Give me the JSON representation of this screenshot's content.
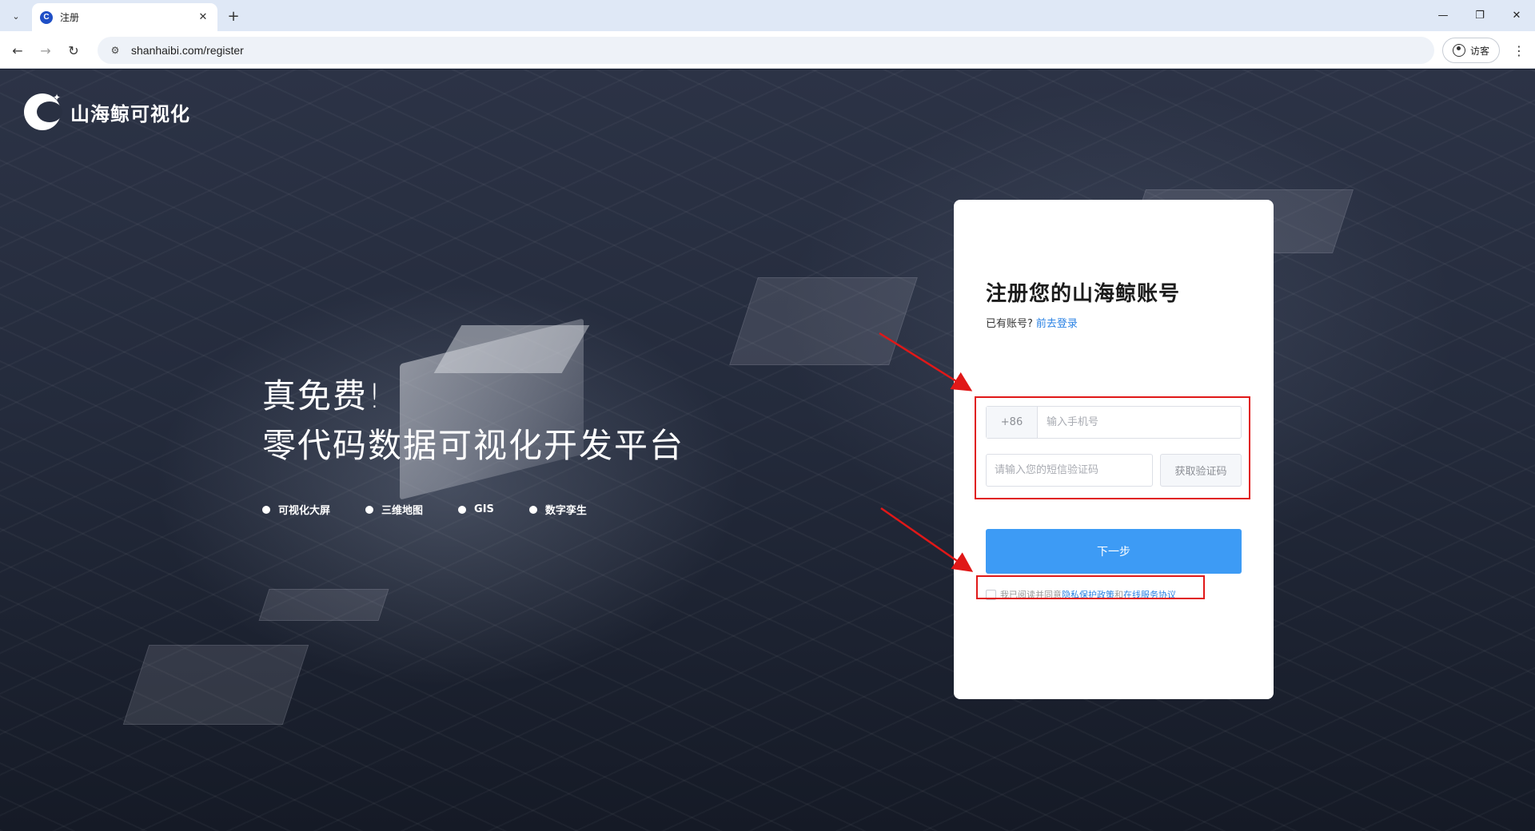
{
  "browser": {
    "tab_title": "注册",
    "favicon_letter": "C",
    "url": "shanhaibi.com/register",
    "profile_label": "访客"
  },
  "brand": {
    "name": "山海鲸可视化"
  },
  "hero": {
    "line1": "真免费!",
    "line2": "零代码数据可视化开发平台",
    "features": [
      "可视化大屏",
      "三维地图",
      "GIS",
      "数字孪生"
    ]
  },
  "register": {
    "title": "注册您的山海鲸账号",
    "have_account": "已有账号?",
    "login_link": "前去登录",
    "country_code": "+86",
    "phone_placeholder": "输入手机号",
    "code_placeholder": "请输入您的短信验证码",
    "get_code_label": "获取验证码",
    "next_label": "下一步",
    "agree_prefix": "我已阅读并同意",
    "privacy_link": "隐私保护政策",
    "agree_and": "和",
    "terms_link": "在线服务协议"
  },
  "colors": {
    "accent": "#3d9bf5",
    "link": "#2a82e4",
    "annotation": "#e01818"
  }
}
